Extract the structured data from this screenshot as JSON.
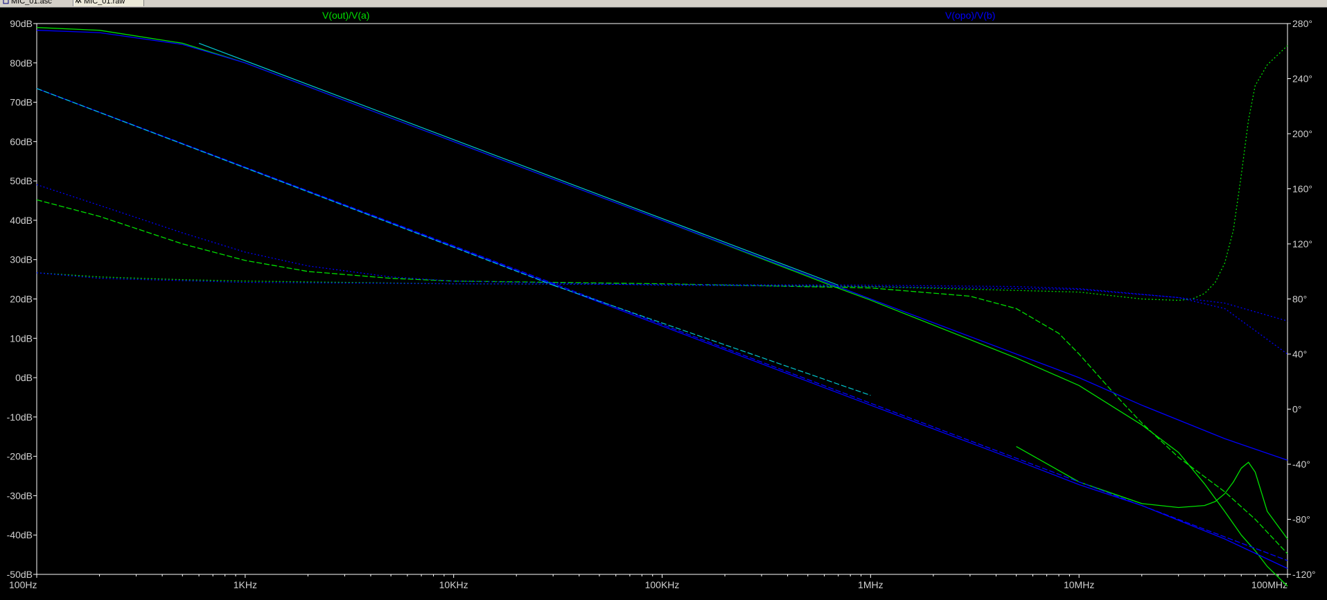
{
  "tabs": [
    {
      "label": "MIC_01.asc",
      "icon": "schematic-icon"
    },
    {
      "label": "MIC_01.raw",
      "icon": "waveform-icon"
    }
  ],
  "colors": {
    "background": "#000000",
    "frame": "#ffffff",
    "tick_text": "#d0d0d0",
    "trace_green": "#00e000",
    "trace_blue": "#0000ff",
    "overlap": "#00c8d0"
  },
  "chart_data": {
    "type": "line",
    "title": "",
    "x_scale": "log",
    "xlim": [
      100,
      100000000
    ],
    "ylim_left": [
      -50,
      90
    ],
    "ylim_right": [
      -120,
      280
    ],
    "grid": false,
    "x_ticks": [
      {
        "v": 100,
        "label": "100Hz"
      },
      {
        "v": 1000,
        "label": "1KHz"
      },
      {
        "v": 10000,
        "label": "10KHz"
      },
      {
        "v": 100000,
        "label": "100KHz"
      },
      {
        "v": 1000000,
        "label": "1MHz"
      },
      {
        "v": 10000000,
        "label": "10MHz"
      },
      {
        "v": 100000000,
        "label": "100MHz"
      }
    ],
    "y_left_ticks": [
      {
        "v": 90,
        "label": "90dB"
      },
      {
        "v": 80,
        "label": "80dB"
      },
      {
        "v": 70,
        "label": "70dB"
      },
      {
        "v": 60,
        "label": "60dB"
      },
      {
        "v": 50,
        "label": "50dB"
      },
      {
        "v": 40,
        "label": "40dB"
      },
      {
        "v": 30,
        "label": "30dB"
      },
      {
        "v": 20,
        "label": "20dB"
      },
      {
        "v": 10,
        "label": "10dB"
      },
      {
        "v": 0,
        "label": "0dB"
      },
      {
        "v": -10,
        "label": "-10dB"
      },
      {
        "v": -20,
        "label": "-20dB"
      },
      {
        "v": -30,
        "label": "-30dB"
      },
      {
        "v": -40,
        "label": "-40dB"
      },
      {
        "v": -50,
        "label": "-50dB"
      }
    ],
    "y_right_ticks": [
      {
        "v": 280,
        "label": "280°"
      },
      {
        "v": 240,
        "label": "240°"
      },
      {
        "v": 200,
        "label": "200°"
      },
      {
        "v": 160,
        "label": "160°"
      },
      {
        "v": 120,
        "label": "120°"
      },
      {
        "v": 80,
        "label": "80°"
      },
      {
        "v": 40,
        "label": "40°"
      },
      {
        "v": 0,
        "label": "0°"
      },
      {
        "v": -40,
        "label": "-40°"
      },
      {
        "v": -80,
        "label": "-80°"
      },
      {
        "v": -120,
        "label": "-120°"
      }
    ],
    "traces": [
      {
        "name": "V(out)/V(a)",
        "color": "#00e000",
        "axis": "left",
        "dash": "none",
        "x": [
          100,
          200,
          500,
          1000,
          2000,
          5000,
          10000,
          100000,
          680000,
          1000000,
          5000000,
          10000000,
          20000000,
          30000000,
          40000000,
          50000000,
          60000000,
          70000000,
          80000000,
          100000000
        ],
        "y": [
          89,
          88.3,
          85,
          80,
          74,
          66,
          60,
          40,
          23,
          19.7,
          5,
          -2,
          -12,
          -19,
          -27,
          -34,
          -40,
          -44,
          -48,
          -53
        ]
      },
      {
        "name": "V(out)/V(a)",
        "color": "#00e000",
        "axis": "left",
        "dash": "none",
        "x": [
          5000000,
          10000000,
          20000000,
          30000000,
          40000000,
          45000000,
          50000000,
          55000000,
          60000000,
          65000000,
          70000000,
          80000000,
          100000000
        ],
        "y": [
          -17.5,
          -26.5,
          -32,
          -33,
          -32.5,
          -31.5,
          -29.5,
          -26.5,
          -23,
          -21.5,
          -24,
          -34,
          -41
        ]
      },
      {
        "name": "V(out)/V(a)",
        "color": "#00e000",
        "axis": "right",
        "dash": "dash",
        "x": [
          100,
          200,
          500,
          1000,
          2000,
          5000,
          10000,
          100000,
          1000000,
          3000000,
          5000000,
          8000000,
          10000000,
          15000000,
          20000000,
          30000000,
          50000000,
          70000000,
          100000000
        ],
        "y": [
          152,
          140,
          120,
          108,
          100,
          95,
          93,
          91,
          88,
          82,
          73,
          55,
          40,
          10,
          -10,
          -35,
          -60,
          -80,
          -105
        ]
      },
      {
        "name": "V(out)/V(a)",
        "color": "#00e000",
        "axis": "right",
        "dash": "dot",
        "x": [
          100,
          200,
          500,
          1000,
          10000,
          100000,
          1000000,
          10000000,
          20000000,
          30000000,
          35000000,
          40000000,
          45000000,
          50000000,
          55000000,
          60000000,
          65000000,
          70000000,
          80000000,
          100000000
        ],
        "y": [
          99,
          96,
          94,
          93,
          91,
          90.5,
          89,
          85,
          80,
          79,
          80,
          84,
          92,
          106,
          130,
          170,
          210,
          235,
          250,
          264
        ]
      },
      {
        "name": "V(opo)/V(b)",
        "color": "#0000ff",
        "axis": "left",
        "dash": "none",
        "x": [
          100,
          200,
          500,
          1000,
          2000,
          5000,
          10000,
          100000,
          1000000,
          5000000,
          10000000,
          20000000,
          50000000,
          100000000
        ],
        "y": [
          88.3,
          87.7,
          84.7,
          80,
          74,
          66,
          60,
          40,
          20,
          6,
          0,
          -7,
          -15.5,
          -21
        ]
      },
      {
        "name": "V(opo)/V(b)",
        "color": "#0000ff",
        "axis": "left",
        "dash": "none",
        "x": [
          100,
          1000000,
          5000000,
          10000000,
          20000000,
          50000000,
          100000000
        ],
        "y": [
          73.5,
          -7,
          -21,
          -27.2,
          -32.5,
          -41,
          -48.5
        ]
      },
      {
        "name": "V(opo)/V(b)",
        "color": "#0000ff",
        "axis": "left",
        "dash": "dash",
        "x": [
          100,
          100000000
        ],
        "y": [
          73.5,
          -46.5
        ]
      },
      {
        "name": "V(opo)/V(b)",
        "color": "#0000ff",
        "axis": "right",
        "dash": "dot",
        "x": [
          100,
          200,
          500,
          1000,
          2000,
          5000,
          10000,
          100000,
          1000000,
          10000000,
          30000000,
          50000000,
          100000000
        ],
        "y": [
          163,
          148,
          128,
          114,
          104,
          96,
          93,
          90,
          89,
          87,
          81,
          73,
          40
        ]
      },
      {
        "name": "V(opo)/V(b)",
        "color": "#0000ff",
        "axis": "right",
        "dash": "dot",
        "x": [
          100,
          200,
          1000,
          10000,
          100000,
          1000000,
          5000000,
          10000000,
          30000000,
          50000000,
          100000000
        ],
        "y": [
          99,
          95,
          92,
          91,
          90.5,
          90,
          89,
          87.5,
          81,
          77,
          64
        ]
      }
    ],
    "overlap_segments": [
      {
        "x": [
          600,
          700000
        ],
        "y": [
          85,
          23.5
        ],
        "axis": "left",
        "dash": "none"
      },
      {
        "x": [
          100,
          30000
        ],
        "y": [
          73.5,
          23.5
        ],
        "axis": "left",
        "dash": "dash"
      },
      {
        "x": [
          30000,
          1000000
        ],
        "y": [
          23.5,
          -4.5
        ],
        "axis": "left",
        "dash": "dash"
      }
    ],
    "legend": [
      {
        "name": "V(out)/V(a)",
        "color": "#00e000"
      },
      {
        "name": "V(opo)/V(b)",
        "color": "#0000ff"
      }
    ]
  }
}
